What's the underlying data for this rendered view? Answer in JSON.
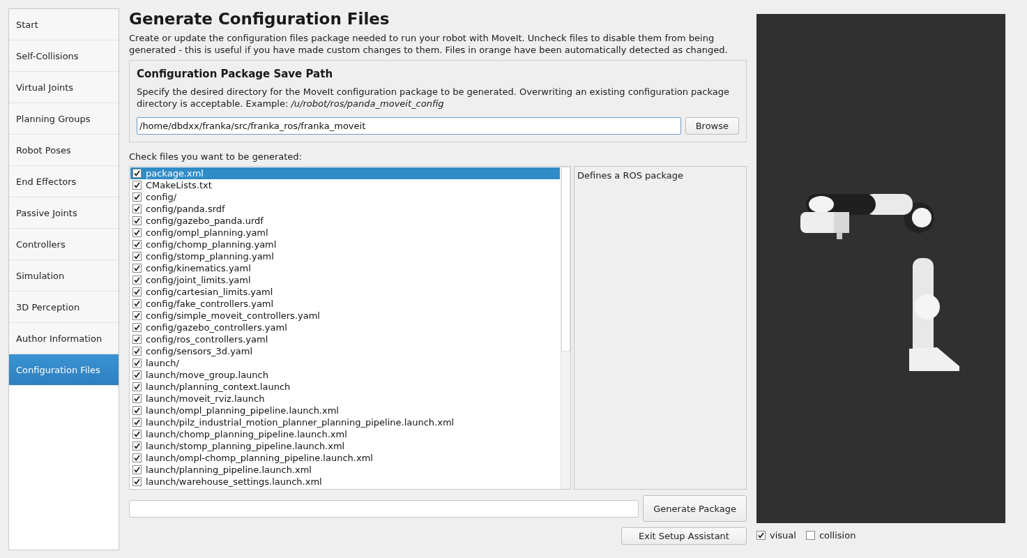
{
  "sidebar": {
    "items": [
      {
        "label": "Start",
        "selected": false
      },
      {
        "label": "Self-Collisions",
        "selected": false
      },
      {
        "label": "Virtual Joints",
        "selected": false
      },
      {
        "label": "Planning Groups",
        "selected": false
      },
      {
        "label": "Robot Poses",
        "selected": false
      },
      {
        "label": "End Effectors",
        "selected": false
      },
      {
        "label": "Passive Joints",
        "selected": false
      },
      {
        "label": "Controllers",
        "selected": false
      },
      {
        "label": "Simulation",
        "selected": false
      },
      {
        "label": "3D Perception",
        "selected": false
      },
      {
        "label": "Author Information",
        "selected": false
      },
      {
        "label": "Configuration Files",
        "selected": true
      }
    ]
  },
  "title": "Generate Configuration Files",
  "description": "Create or update the configuration files package needed to run your robot with MoveIt. Uncheck files to disable them from being generated - this is useful if you have made custom changes to them. Files in orange have been automatically detected as changed.",
  "save_path": {
    "heading": "Configuration Package Save Path",
    "description": "Specify the desired directory for the MoveIt configuration package to be generated. Overwriting an existing configuration package directory is acceptable. Example: */u/robot/ros/panda_moveit_config*",
    "value": "/home/dbdxx/franka/src/franka_ros/franka_moveit",
    "button": "Browse"
  },
  "files_label": "Check files you want to be generated:",
  "files": [
    {
      "name": "package.xml",
      "checked": true,
      "selected": true
    },
    {
      "name": "CMakeLists.txt",
      "checked": true,
      "selected": false
    },
    {
      "name": "config/",
      "checked": true,
      "selected": false
    },
    {
      "name": "config/panda.srdf",
      "checked": true,
      "selected": false
    },
    {
      "name": "config/gazebo_panda.urdf",
      "checked": true,
      "selected": false
    },
    {
      "name": "config/ompl_planning.yaml",
      "checked": true,
      "selected": false
    },
    {
      "name": "config/chomp_planning.yaml",
      "checked": true,
      "selected": false
    },
    {
      "name": "config/stomp_planning.yaml",
      "checked": true,
      "selected": false
    },
    {
      "name": "config/kinematics.yaml",
      "checked": true,
      "selected": false
    },
    {
      "name": "config/joint_limits.yaml",
      "checked": true,
      "selected": false
    },
    {
      "name": "config/cartesian_limits.yaml",
      "checked": true,
      "selected": false
    },
    {
      "name": "config/fake_controllers.yaml",
      "checked": true,
      "selected": false
    },
    {
      "name": "config/simple_moveit_controllers.yaml",
      "checked": true,
      "selected": false
    },
    {
      "name": "config/gazebo_controllers.yaml",
      "checked": true,
      "selected": false
    },
    {
      "name": "config/ros_controllers.yaml",
      "checked": true,
      "selected": false
    },
    {
      "name": "config/sensors_3d.yaml",
      "checked": true,
      "selected": false
    },
    {
      "name": "launch/",
      "checked": true,
      "selected": false
    },
    {
      "name": "launch/move_group.launch",
      "checked": true,
      "selected": false
    },
    {
      "name": "launch/planning_context.launch",
      "checked": true,
      "selected": false
    },
    {
      "name": "launch/moveit_rviz.launch",
      "checked": true,
      "selected": false
    },
    {
      "name": "launch/ompl_planning_pipeline.launch.xml",
      "checked": true,
      "selected": false
    },
    {
      "name": "launch/pilz_industrial_motion_planner_planning_pipeline.launch.xml",
      "checked": true,
      "selected": false
    },
    {
      "name": "launch/chomp_planning_pipeline.launch.xml",
      "checked": true,
      "selected": false
    },
    {
      "name": "launch/stomp_planning_pipeline.launch.xml",
      "checked": true,
      "selected": false
    },
    {
      "name": "launch/ompl-chomp_planning_pipeline.launch.xml",
      "checked": true,
      "selected": false
    },
    {
      "name": "launch/planning_pipeline.launch.xml",
      "checked": true,
      "selected": false
    },
    {
      "name": "launch/warehouse_settings.launch.xml",
      "checked": true,
      "selected": false
    }
  ],
  "file_description": "Defines a ROS package",
  "progress": {
    "level": 0
  },
  "generate_button": "Generate Package",
  "exit_button": "Exit Setup Assistant",
  "viewport": {
    "options": [
      {
        "label": "visual",
        "checked": true
      },
      {
        "label": "collision",
        "checked": false
      }
    ]
  }
}
